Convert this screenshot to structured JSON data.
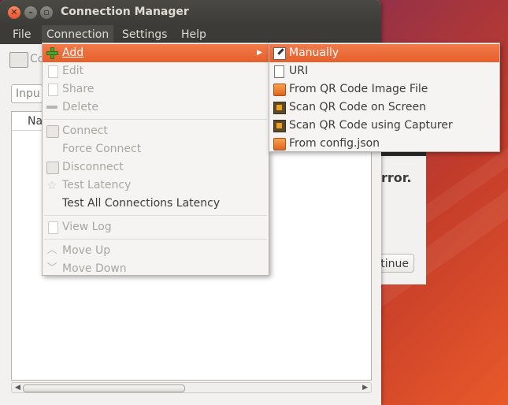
{
  "window": {
    "title": "Connection Manager"
  },
  "menubar": {
    "items": [
      "File",
      "Connection",
      "Settings",
      "Help"
    ]
  },
  "main": {
    "toolbar_label": "Co",
    "input_value": "Inpu",
    "list_header": "Na"
  },
  "background_dialog": {
    "error_text": "rror.",
    "continue_label": "tinue"
  },
  "connection_menu": {
    "add": "Add",
    "edit": "Edit",
    "share": "Share",
    "delete": "Delete",
    "connect": "Connect",
    "force_connect": "Force Connect",
    "disconnect": "Disconnect",
    "test_latency": "Test Latency",
    "test_all": "Test All Connections Latency",
    "view_log": "View Log",
    "move_up": "Move Up",
    "move_down": "Move Down"
  },
  "add_submenu": {
    "manually": "Manually",
    "uri": "URI",
    "qr_image": "From QR Code Image File",
    "scan_screen": "Scan QR Code on Screen",
    "scan_capturer": "Scan QR Code using Capturer",
    "config_json": "From config.json"
  },
  "colors": {
    "highlight": "#e6602c",
    "titlebar": "#3c3b37"
  }
}
